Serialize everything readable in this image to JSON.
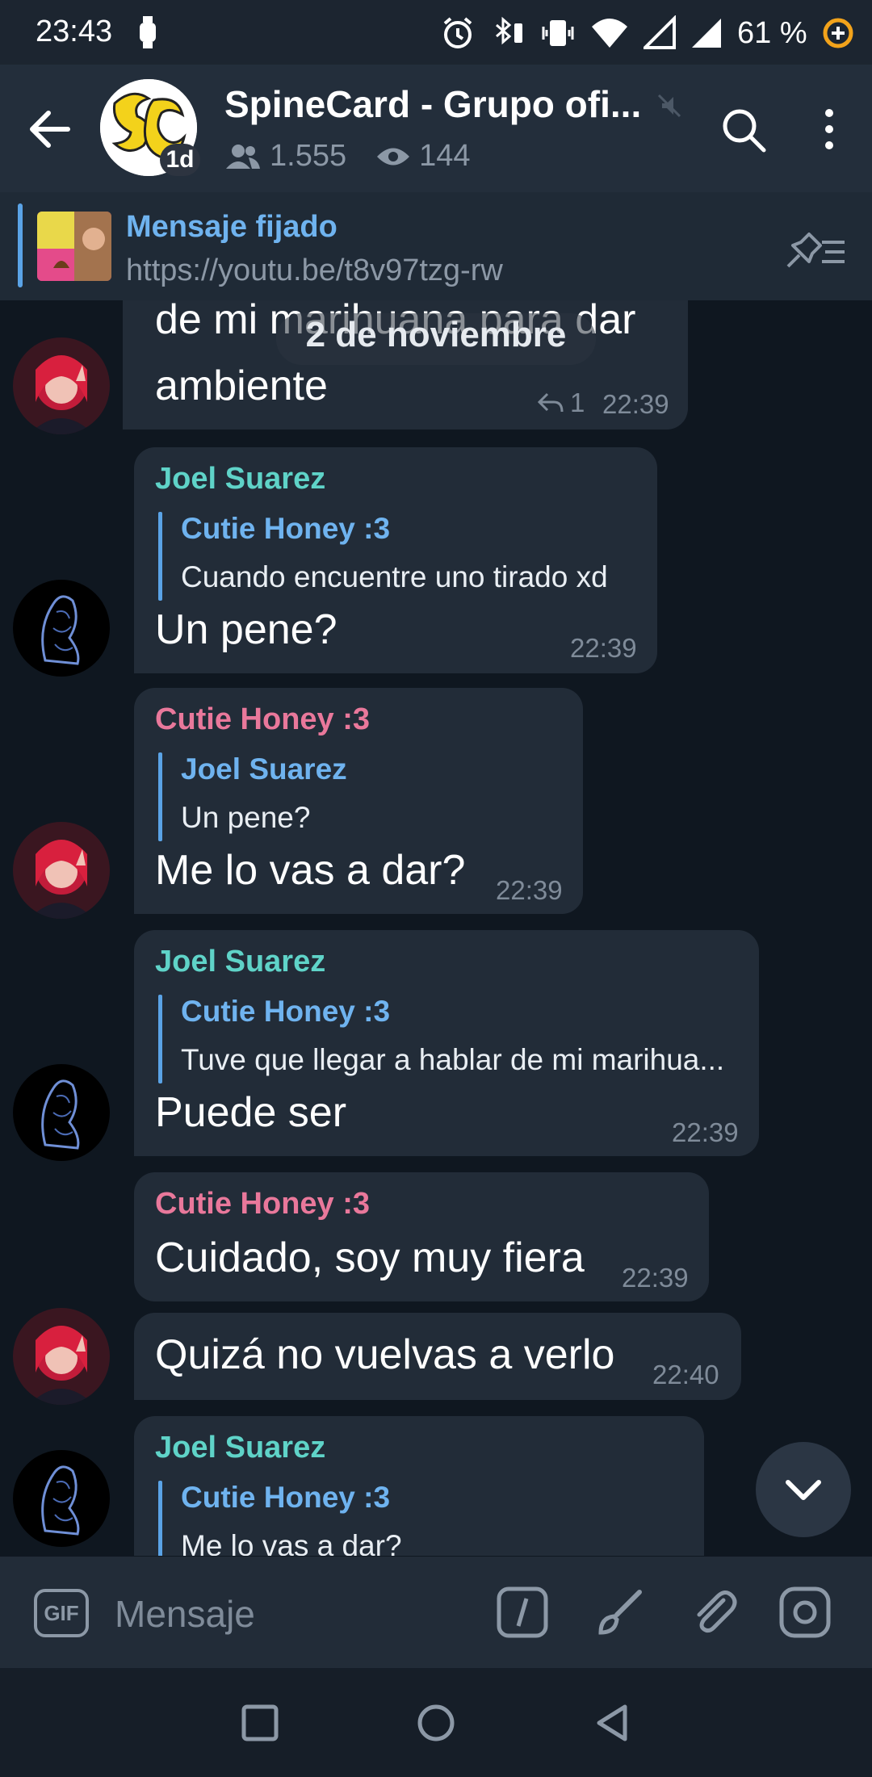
{
  "status_bar": {
    "time": "23:43",
    "battery": "61 %"
  },
  "header": {
    "title": "SpineCard - Grupo ofi...",
    "members": "1.555",
    "views": "144",
    "avatar_badge": "1d"
  },
  "pinned": {
    "title": "Mensaje fijado",
    "subtitle": "https://youtu.be/t8v97tzg-rw"
  },
  "date_chip": "2 de noviembre",
  "messages": [
    {
      "sender": "",
      "lines": [
        "de mi marihuana para dar",
        "ambiente"
      ],
      "replies": "1",
      "time": "22:39"
    },
    {
      "sender": "Joel Suarez",
      "quote_name": "Cutie Honey :3",
      "quote_text": "Cuando encuentre uno tirado xd",
      "text": "Un pene?",
      "time": "22:39"
    },
    {
      "sender": "Cutie Honey :3",
      "quote_name": "Joel Suarez",
      "quote_text": "Un pene?",
      "text": "Me lo vas a dar?",
      "time": "22:39"
    },
    {
      "sender": "Joel Suarez",
      "quote_name": "Cutie Honey :3",
      "quote_text": "Tuve que llegar a hablar de mi marihua...",
      "text": "Puede ser",
      "time": "22:39"
    },
    {
      "sender": "Cutie Honey :3",
      "text": "Cuidado, soy muy fiera",
      "time": "22:39"
    },
    {
      "sender": "",
      "text": "Quizá no vuelvas a verlo",
      "time": "22:40"
    },
    {
      "sender": "Joel Suarez",
      "quote_name": "Cutie Honey :3",
      "quote_text": "Me lo vas a dar?"
    }
  ],
  "input": {
    "placeholder": "Mensaje",
    "gif_label": "GIF"
  },
  "colors": {
    "joel": "#5fd3c8",
    "cutie": "#e9789b",
    "quote_accent": "#5aa3e6",
    "background": "#0f1720",
    "bubble": "#222c38"
  },
  "icons": [
    "back-arrow-icon",
    "mute-icon",
    "search-icon",
    "more-vert-icon",
    "pin-list-icon",
    "reply-icon",
    "chevron-down-icon",
    "gif-icon",
    "command-icon",
    "brush-icon",
    "attach-icon",
    "camera-icon"
  ]
}
